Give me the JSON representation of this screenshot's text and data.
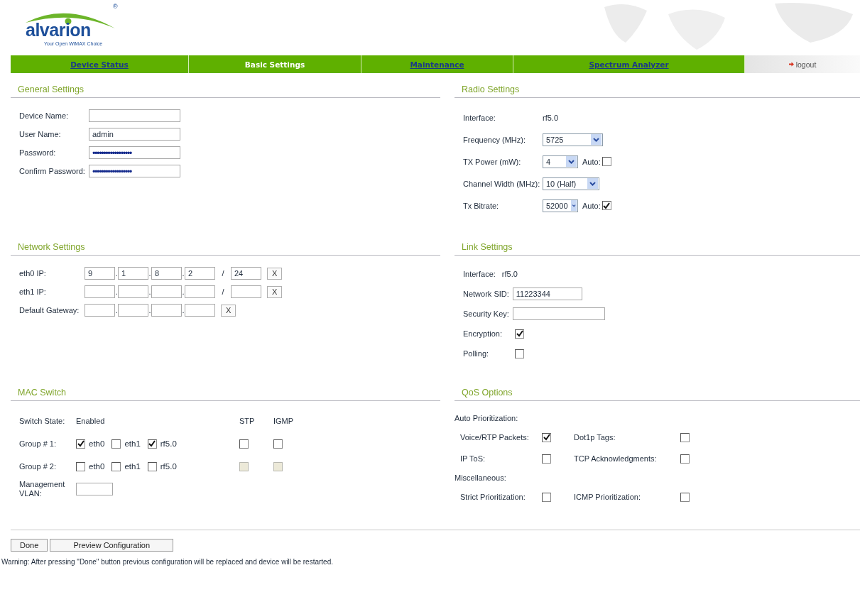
{
  "brand": {
    "name": "alvarion",
    "tagline": "Your Open WiMAX Choice",
    "mark": "®"
  },
  "nav": {
    "tabs": [
      {
        "label": "Device Status",
        "selected": false
      },
      {
        "label": "Basic Settings",
        "selected": true
      },
      {
        "label": "Maintenance",
        "selected": false
      },
      {
        "label": "Spectrum Analyzer",
        "selected": false
      }
    ],
    "logout": "logout"
  },
  "general": {
    "title": "General Settings",
    "fields": [
      {
        "label": "Device Name:"
      },
      {
        "label": "User Name:",
        "value": "admin"
      },
      {
        "label": "Password:",
        "value": "••••••••••••••••••"
      },
      {
        "label": "Confirm Password:",
        "value": "••••••••••••••••••"
      }
    ]
  },
  "radio": {
    "title": "Radio Settings",
    "rows": [
      {
        "label": "Interface:",
        "kind": "text",
        "value": "rf5.0"
      },
      {
        "label": "Frequency (MHz):",
        "kind": "select",
        "value": "5725"
      },
      {
        "label": "TX Power (mW):",
        "kind": "select",
        "value": "4",
        "auto": {
          "label": "Auto:",
          "checked": false
        }
      },
      {
        "label": "Channel Width (MHz):",
        "kind": "select",
        "value": "10 (Half)"
      },
      {
        "label": "Tx Bitrate:",
        "kind": "select",
        "value": "52000",
        "auto": {
          "label": "Auto:",
          "checked": true
        }
      }
    ]
  },
  "network": {
    "title": "Network Settings",
    "separator": ".",
    "mask_separator": "/",
    "rows": [
      {
        "label": "eth0 IP:",
        "kind": "ip_mask",
        "octets": [
          "9",
          "1",
          "8",
          "2"
        ],
        "mask": "24",
        "clear": "X"
      },
      {
        "label": "eth1 IP:",
        "kind": "ip_mask",
        "clear": "X"
      },
      {
        "label": "Default Gateway:",
        "kind": "ip",
        "clear": "X"
      }
    ]
  },
  "link": {
    "title": "Link Settings",
    "rows": [
      {
        "label": "Interface:",
        "kind": "text",
        "value": "rf5.0"
      },
      {
        "label": "Network SID:",
        "kind": "input",
        "value": "11223344"
      },
      {
        "label": "Security Key:",
        "kind": "input"
      },
      {
        "label": "Encryption:",
        "kind": "checkbox",
        "checked": true
      },
      {
        "label": "Polling:",
        "kind": "checkbox",
        "checked": false
      }
    ]
  },
  "mac": {
    "title": "MAC Switch",
    "state_label": "Switch State:",
    "state": "Enabled",
    "columns": [
      "STP",
      "IGMP"
    ],
    "groups": [
      {
        "label": "Group # 1:",
        "ports": [
          {
            "name": "eth0",
            "checked": true
          },
          {
            "name": "eth1",
            "checked": false
          },
          {
            "name": "rf5.0",
            "checked": true
          }
        ],
        "flags": [
          {
            "checked": false,
            "disabled": false
          },
          {
            "checked": false,
            "disabled": false
          }
        ]
      },
      {
        "label": "Group # 2:",
        "ports": [
          {
            "name": "eth0",
            "checked": false
          },
          {
            "name": "eth1",
            "checked": false
          },
          {
            "name": "rf5.0",
            "checked": false
          }
        ],
        "flags": [
          {
            "checked": false,
            "disabled": true
          },
          {
            "checked": false,
            "disabled": true
          }
        ]
      }
    ],
    "vlan_label": "Management VLAN:"
  },
  "qos": {
    "title": "QoS Options",
    "groups": [
      {
        "title": "Auto Prioritization:",
        "items": [
          {
            "label": "Voice/RTP Packets:",
            "checked": true
          },
          {
            "label": "Dot1p Tags:",
            "checked": false
          },
          {
            "label": "IP ToS:",
            "checked": false
          },
          {
            "label": "TCP Acknowledgments:",
            "checked": false
          }
        ]
      },
      {
        "title": "Miscellaneous:",
        "items": [
          {
            "label": "Strict Prioritization:",
            "checked": false
          },
          {
            "label": "ICMP Prioritization:",
            "checked": false
          }
        ]
      }
    ]
  },
  "footer": {
    "buttons": [
      "Done",
      "Preview Configuration"
    ],
    "warning": "Warning: After pressing \"Done\" button previous configuration will be replaced and device will be restarted."
  }
}
